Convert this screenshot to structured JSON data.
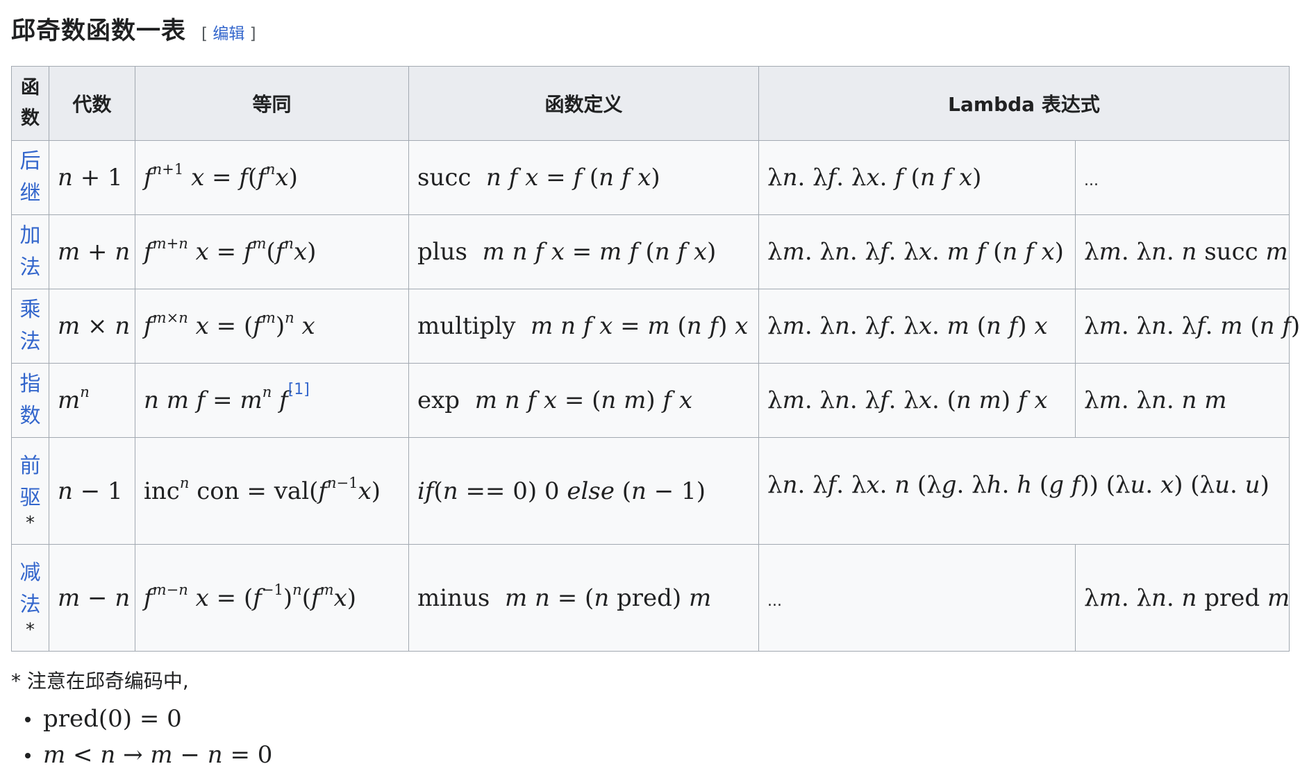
{
  "heading": {
    "title": "邱奇数函数一表",
    "edit_open": "[",
    "edit_label": "编辑",
    "edit_close": "]"
  },
  "table": {
    "headers": {
      "function": "函数",
      "algebra": "代数",
      "identity": "等同",
      "definition": "函数定义",
      "lambda": "Lambda 表达式"
    },
    "rows": [
      {
        "name": "后继",
        "star": "",
        "algebra": "n + 1",
        "identity": "f^(n+1) x = f(f^n x)",
        "definition": "succ  n f x = f (n f x)",
        "lambda1": "λn. λf. λx. f (n f x)",
        "lambda2": "..."
      },
      {
        "name": "加法",
        "star": "",
        "algebra": "m + n",
        "identity": "f^(m+n) x = f^m (f^n x)",
        "definition": "plus  m n f x = m f (n f x)",
        "lambda1": "λm. λn. λf. λx. m f (n f x)",
        "lambda2": "λm. λn. n succ m"
      },
      {
        "name": "乘法",
        "star": "",
        "algebra": "m × n",
        "identity": "f^(m×n) x = (f^m)^n x",
        "definition": "multiply  m n f x = m (n f) x",
        "lambda1": "λm. λn. λf. λx. m (n f) x",
        "lambda2": "λm. λn. λf. m (n f)"
      },
      {
        "name": "指数",
        "star": "",
        "algebra": "m^n",
        "identity": "n m f = m^n f",
        "identity_ref": "[1]",
        "definition": "exp  m n f x = (n m) f x",
        "lambda1": "λm. λn. λf. λx. (n m) f x",
        "lambda2": "λm. λn. n m"
      },
      {
        "name": "前驱",
        "star": "*",
        "algebra": "n − 1",
        "identity": "inc^n con = val(f^(n−1) x)",
        "definition": "if(n == 0) 0 else (n − 1)",
        "lambda": "λn. λf. λx. n (λg. λh. h (g f)) (λu. x) (λu. u)"
      },
      {
        "name": "减法",
        "star": "*",
        "algebra": "m − n",
        "identity": "f^(m−n) x = (f^(−1))^n (f^m x)",
        "definition": "minus  m n = (n pred) m",
        "lambda1": "...",
        "lambda2": "λm. λn. n pred m"
      }
    ]
  },
  "notes": {
    "intro": "* 注意在邱奇编码中,",
    "items": [
      "pred(0) = 0",
      "m < n → m − n = 0"
    ]
  }
}
